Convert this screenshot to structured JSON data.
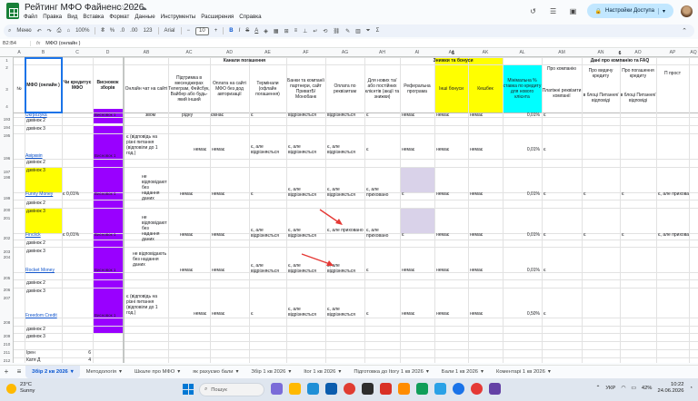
{
  "doc": {
    "title": "Рейтинг МФО Файненс 2026",
    "menu": [
      "Файл",
      "Правка",
      "Вид",
      "Вставка",
      "Формат",
      "Данные",
      "Инструменты",
      "Расширения",
      "Справка"
    ],
    "share_label": "Настройки Доступа"
  },
  "toolbar": {
    "menu_label": "Меню",
    "zoom": "100%",
    "currency": "₴",
    "percent": "%",
    "dec1": ".0",
    "dec2": ".00",
    "num": "123",
    "font": "Arial",
    "font_size": "10",
    "bold": "B",
    "italic": "I",
    "strike": "S",
    "textcolor": "A"
  },
  "formula_bar": {
    "cell_ref": "B2:B4",
    "fx": "fx",
    "content": "МФО (онлайн )"
  },
  "columns": [
    "A",
    "B",
    "C",
    "D",
    "AB",
    "AC",
    "AD",
    "AE",
    "AF",
    "AG",
    "AH",
    "AI",
    "AJ",
    "AK",
    "AL",
    "AM",
    "AN",
    "AO",
    "AP",
    "AQ"
  ],
  "row_numbers": [
    "1",
    "2",
    "3",
    "4",
    "193",
    "194",
    "195",
    "196",
    "197",
    "198",
    "199",
    "200",
    "201",
    "202",
    "203",
    "204",
    "205",
    "206",
    "207",
    "208",
    "209",
    "210",
    "211",
    "212",
    "213",
    "214",
    "215",
    "216",
    "217",
    "218",
    "219",
    "220",
    "221",
    "222",
    "223"
  ],
  "headers": {
    "num": "№",
    "mfo": "МФО (онлайн )",
    "credit": "Чи кредитує МФО",
    "rating": "Висновок зборів",
    "group_channels": "Канали погашення",
    "group_discounts": "Знижки та бонуси",
    "group_info": "Дані про компанію та FAQ",
    "group5": "5",
    "group6": "6",
    "ab": "Онлайн чат на сайті",
    "ac": "Підтримка в месенджерах Телеграм, Фейсбук, Вайбер або будь-який інший",
    "ad": "Оплата на сайті МФО без дод авторизації",
    "ae": "Термінали (офлайн погашення)",
    "af": "Банки та компанії партнери, сайт ПриватБ/Монобанк",
    "ag": "Оплата по реквізитам",
    "ah": "Для нових та/або постійних клієнтів (акції та знижки)",
    "ai": "Реферальна програма",
    "aj": "Інші бонуси",
    "ak": "Кешбек",
    "al": "Мінімальна % ставка по кредиту для нового клієнта",
    "am": "Про компанію",
    "an": "Платіжні реквізити компанії",
    "ao": "Про видачу кредиту",
    "ao2": "в блоці Питання/відповіді",
    "ap": "Про погашення кредиту",
    "ap2": "в блоці Питання/відповіді",
    "aq": "П прост"
  },
  "rows": {
    "r193_mfo": "Ukrpozyka",
    "r193_ab": "звом",
    "r193_ac": "рідну",
    "r193_ad": "ємнає",
    "r193_ae": "є",
    "r193_af": "відрізняється",
    "r193_ag": "відрізняється",
    "r193_ah": "є",
    "r193_ai": "немає",
    "r193_aj": "немає",
    "r193_ak": "немає",
    "r193_al": "0,01%",
    "r193_am": "є",
    "dz2": "дзвінок 2",
    "dz3": "дзвінок 3",
    "r196_mfo": "Авірквіп",
    "r196_ab": "є (відповідь на різні питання (відповіли до 1 год.)",
    "r196_ac": "немає",
    "r196_ad": "немає",
    "r196_ae": "є, але відрізняється",
    "r196_af": "є, але відрізняється",
    "r196_ag": "є, але відрізняється",
    "r196_ah": "є",
    "r196_ai": "немає",
    "r196_aj": "немає",
    "r196_ak": "немає",
    "r196_al": "0,01%",
    "r196_am": "є",
    "r199_mfo": "Funny Money",
    "r199_credit": "є 0,01%",
    "r199_ab": "не відповідають без надання даних",
    "r199_ac": "немає",
    "r199_ad": "немає",
    "r199_ae": "є",
    "r199_af": "є, але відрізняється",
    "r199_ag": "є, але відрізняється",
    "r199_ah": "є, але приховано",
    "r199_ai": "є",
    "r199_aj": "немає",
    "r199_ak": "немає",
    "r199_al": "0,01%",
    "r199_am": "є",
    "r199_ao": "є",
    "r199_ap": "є",
    "r199_aq": "є, але прихова",
    "r202_mfo": "Finclick",
    "r202_credit": "є 0,01%",
    "r202_ab": "не відповідають без надання даних",
    "r202_ac": "немає",
    "r202_ad": "немає",
    "r202_ae": "є, але відрізняється",
    "r202_af": "є, але відрізняється",
    "r202_ag": "є, але приховано",
    "r202_ah": "є, але приховано",
    "r202_ai": "є",
    "r202_aj": "немає",
    "r202_ak": "немає",
    "r202_al": "0,01%",
    "r202_am": "є",
    "r202_ao": "є",
    "r202_ap": "є",
    "r202_aq": "є, але прихова",
    "r205_mfo": "Rocket Money",
    "r205_ab": "не відповідають без надання даних",
    "r205_ac": "немає",
    "r205_ad": "немає",
    "r205_ae": "є, але відрізняється",
    "r205_af": "є, але відрізняється",
    "r205_ag": "є, але відрізняється",
    "r205_ah": "є",
    "r205_ai": "немає",
    "r205_aj": "немає",
    "r205_ak": "немає",
    "r205_al": "0,01%",
    "r205_am": "є",
    "r208_mfo": "Freedom Credit",
    "r208_ab": "є (відповідь на різні питання (відповіли до 1 год.)",
    "r208_ac": "немає",
    "r208_ad": "немає",
    "r208_ae": "є",
    "r208_af": "є, але відрізняється",
    "r208_ag": "є, але відрізняється",
    "r208_ah": "є",
    "r208_ai": "немає",
    "r208_aj": "немає",
    "r208_ak": "немає",
    "r208_al": "0,50%",
    "r208_am": "є",
    "rating_text": "Висновок 1",
    "sum_label1": "Ірен",
    "sum_val1": "6",
    "sum_label2": "Катя Д",
    "sum_val2": "4"
  },
  "tabs": {
    "active": "Збір 2 кв 2026",
    "others": [
      "Методологія",
      "Шкале про МФО",
      "як рахуємо бали",
      "Збір 1 кв 2026",
      "Itoг 1 кв 2026",
      "Підготовка до Itoгу 1 кв 2026",
      "Бали 1 кв 2026",
      "Коментарі 1 кв 2026"
    ]
  },
  "taskbar": {
    "temp": "23°C",
    "weather": "Sunny",
    "search": "Пошук",
    "lang": "УКР",
    "battery": "42%",
    "time": "10:22",
    "date": "24.06.2026"
  },
  "colors": {
    "yellow": "#ffff00",
    "purple": "#9900ff",
    "lavender": "#d9d2e9",
    "cyan": "#00ffff",
    "accent": "#0b57d0",
    "arrow_red": "#e53935"
  }
}
